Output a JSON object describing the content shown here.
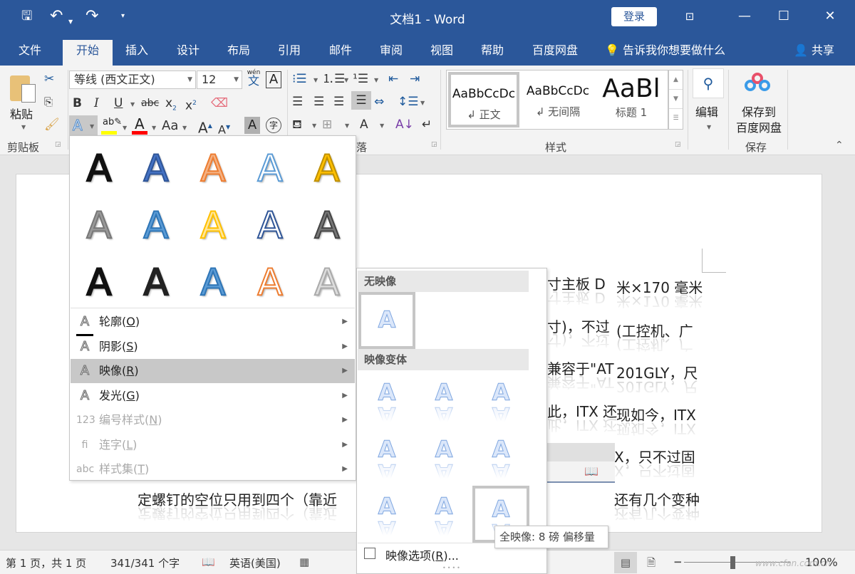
{
  "titlebar": {
    "title": "文档1  -  Word",
    "login": "登录",
    "qat": {
      "save": "save-icon",
      "undo": "undo-icon",
      "redo": "redo-icon",
      "customize": "customize-icon"
    }
  },
  "tabs": [
    "文件",
    "开始",
    "插入",
    "设计",
    "布局",
    "引用",
    "邮件",
    "审阅",
    "视图",
    "帮助",
    "百度网盘"
  ],
  "active_tab": "开始",
  "tell_me": "告诉我你想要做什么",
  "share": "共享",
  "ribbon": {
    "clipboard": {
      "paste": "粘贴",
      "label": "剪贴板"
    },
    "font": {
      "name": "等线 (西文正文)",
      "size": "12",
      "phonetic_top": "wén",
      "phonetic_bottom": "文"
    },
    "paragraph": {
      "label": "落"
    },
    "styles": {
      "label": "样式",
      "items": [
        {
          "sample": "AaBbCcDc",
          "name": "↲ 正文"
        },
        {
          "sample": "AaBbCcDc",
          "name": "↲ 无间隔"
        },
        {
          "sample": "AaBl",
          "name": "标题 1"
        }
      ]
    },
    "editing": {
      "label": "编辑"
    },
    "save": {
      "line1": "保存到",
      "line2": "百度网盘",
      "label": "保存"
    }
  },
  "effects_menu": {
    "styles_grid": [
      [
        "#111111",
        "#4472c4",
        "#f4b183",
        "#ffffff",
        "#ffc000"
      ],
      [
        "#999999",
        "#5b9bd5",
        "#ffe699",
        "#ffffff",
        "#777777"
      ],
      [
        "#111111",
        "#222222",
        "#5b9bd5",
        "#ffffff",
        "#dddddd"
      ]
    ],
    "items": [
      {
        "label": "轮廓(",
        "key": "O",
        "end": ")",
        "icon": "outline-icon",
        "enabled": true,
        "highlighted": false
      },
      {
        "label": "阴影(",
        "key": "S",
        "end": ")",
        "icon": "shadow-icon",
        "enabled": true,
        "highlighted": false
      },
      {
        "label": "映像(",
        "key": "R",
        "end": ")",
        "icon": "reflection-icon",
        "enabled": true,
        "highlighted": true
      },
      {
        "label": "发光(",
        "key": "G",
        "end": ")",
        "icon": "glow-icon",
        "enabled": true,
        "highlighted": false
      },
      {
        "label": "编号样式(",
        "key": "N",
        "end": ")",
        "icon": "number-style-icon",
        "enabled": false,
        "highlighted": false
      },
      {
        "label": "连字(",
        "key": "L",
        "end": ")",
        "icon": "ligature-icon",
        "enabled": false,
        "highlighted": false
      },
      {
        "label": "样式集(",
        "key": "T",
        "end": ")",
        "icon": "stylistic-set-icon",
        "enabled": false,
        "highlighted": false
      }
    ]
  },
  "reflection_menu": {
    "no_reflection": "无映像",
    "variants": "映像变体",
    "options": "映像选项(",
    "options_key": "R",
    "options_end": ")...",
    "tooltip": "全映像: 8 磅 偏移量"
  },
  "document": {
    "lines": [
      {
        "left": "寸主板 D",
        "right": "米×170 毫米"
      },
      {
        "left": "寸)，不过",
        "right": "(工控机、广"
      },
      {
        "left": "兼容于\"AT",
        "right": "201GLY，尺"
      },
      {
        "left": "此，ITX 还",
        "right": "现如今，ITX"
      },
      {
        "left": "",
        "right": "X，只不过固"
      },
      {
        "left": "定螺钉的空位只用到四个（靠近",
        "right": "还有几个变种"
      }
    ]
  },
  "status": {
    "page": "第 1 页，共 1 页",
    "words": "341/341 个字",
    "language": "英语(美国)",
    "zoom": "100%",
    "watermark": "www.cfan.com.cn"
  }
}
